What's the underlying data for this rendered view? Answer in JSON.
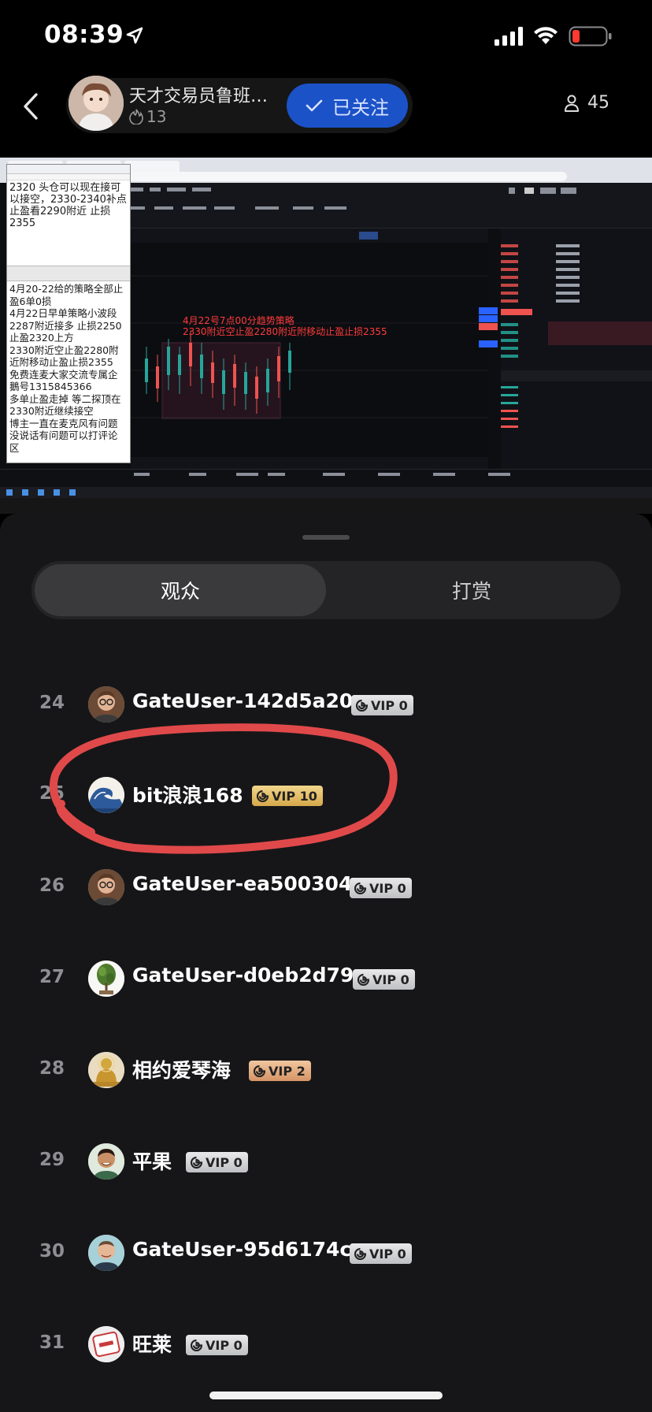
{
  "status_bar": {
    "time": "08:39",
    "colors": {
      "battery_low": "#ff3b30"
    }
  },
  "header": {
    "host_name": "天才交易员鲁班…",
    "host_likes": "13",
    "follow_label": "已关注",
    "viewer_count": "45",
    "colors": {
      "follow_bg": "#1b52c8"
    }
  },
  "stream": {
    "notepad_top": "2320 头仓可以现在接可\n以接空，2330-2340补点\n止盈看2290附近 止损\n2355",
    "notepad_bottom": "4月20-22给的策略全部止\n盈6单0损\n4月22日早单策略小波段\n2287附近接多 止损2250\n止盈2320上方\n2330附近空止盈2280附\n近附移动止盈止损2355\n免费连麦大家交流专属企\n鵝号1315845366\n多单止盈走掉 等二探顶在\n2330附近继续接空\n博主一直在麦克风有问题\n没说话有问题可以打评论\n区",
    "strategy_label": "4月22号7点00分趋势策略\n2330附近空止盈2280附近附移动止盈止损2355"
  },
  "tabs": [
    {
      "label": "观众",
      "active": true
    },
    {
      "label": "打赏",
      "active": false
    }
  ],
  "viewers": [
    {
      "rank": "24",
      "name": "GateUser-142d5a20",
      "vip": "VIP 0",
      "avatar": "man-glasses-avatar"
    },
    {
      "rank": "25",
      "name": "bit浪浪168",
      "vip": "VIP 10",
      "avatar": "wave-avatar"
    },
    {
      "rank": "26",
      "name": "GateUser-ea500304",
      "vip": "VIP 0",
      "avatar": "man-glasses-avatar"
    },
    {
      "rank": "27",
      "name": "GateUser-d0eb2d79",
      "vip": "VIP 0",
      "avatar": "tree-avatar"
    },
    {
      "rank": "28",
      "name": "相约爱琴海",
      "vip": "VIP 2",
      "avatar": "buddha-avatar"
    },
    {
      "rank": "29",
      "name": "平果",
      "vip": "VIP 0",
      "avatar": "smiling-man-avatar"
    },
    {
      "rank": "30",
      "name": "GateUser-95d6174c",
      "vip": "VIP 0",
      "avatar": "bald-man-avatar"
    },
    {
      "rank": "31",
      "name": "旺莱",
      "vip": "VIP 0",
      "avatar": "sticker-avatar"
    }
  ],
  "annotation": {
    "color": "#e0494a"
  }
}
